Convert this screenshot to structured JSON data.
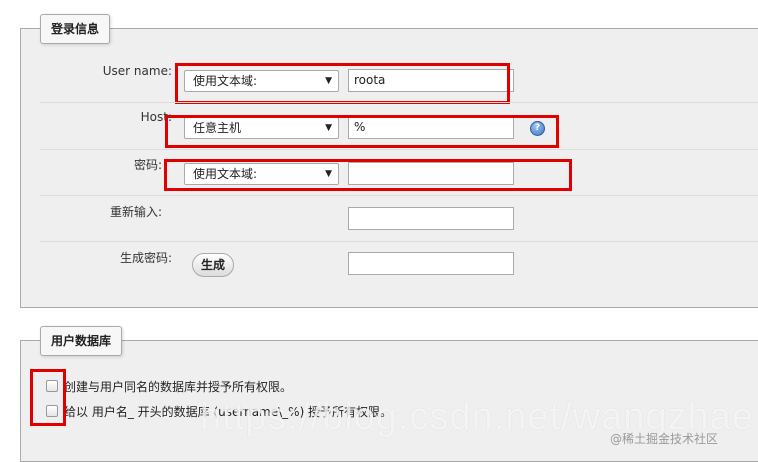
{
  "login": {
    "legend": "登录信息",
    "username_label": "User name:",
    "username_select": "使用文本域:",
    "username_value": "roota",
    "host_label": "Host:",
    "host_select": "任意主机",
    "host_value": "%",
    "password_label": "密码:",
    "password_select": "使用文本域:",
    "password_value": "",
    "retype_label": "重新输入:",
    "retype_value": "",
    "generate_label": "生成密码:",
    "generate_button": "生成",
    "generate_value": ""
  },
  "database": {
    "legend": "用户数据库",
    "option1": "创建与用户同名的数据库并授予所有权限。",
    "option2": "给以 用户名_ 开头的数据库 (username\\_%) 授予所有权限。"
  },
  "watermark": "https://blog.csdn.net/wangzhae",
  "watermark_credit": "@稀土掘金技术社区",
  "colors": {
    "highlight": "#e00000",
    "panel": "#efefef"
  }
}
